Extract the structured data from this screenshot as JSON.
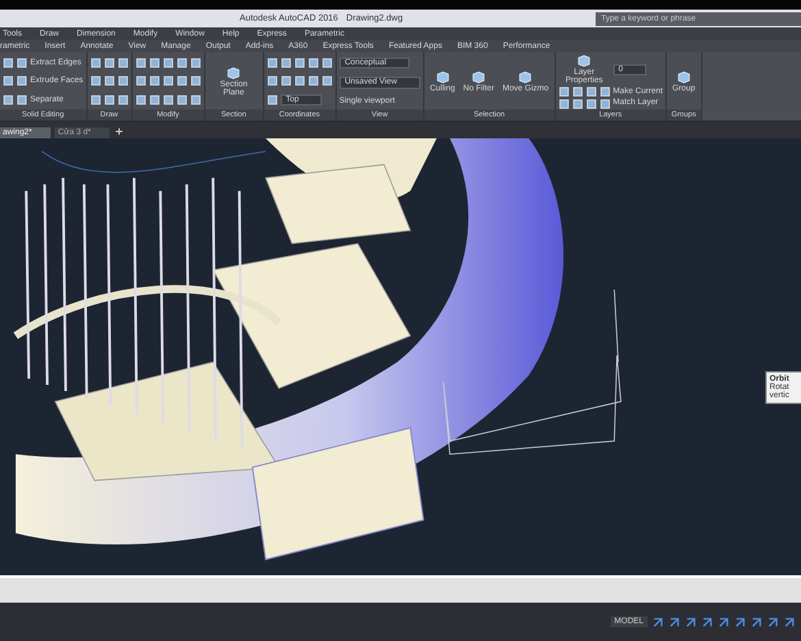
{
  "window": {
    "title": "Autodesk AutoCAD 2016",
    "document": "Drawing2.dwg"
  },
  "search": {
    "placeholder": "Type a keyword or phrase"
  },
  "menu": [
    "Tools",
    "Draw",
    "Dimension",
    "Modify",
    "Window",
    "Help",
    "Express",
    "Parametric"
  ],
  "ribbon_tabs": [
    "rametric",
    "Insert",
    "Annotate",
    "View",
    "Manage",
    "Output",
    "Add-ins",
    "A360",
    "Express Tools",
    "Featured Apps",
    "BIM 360",
    "Performance"
  ],
  "panels": [
    {
      "label": "Solid Editing",
      "rows": [
        [
          {
            "kind": "icon"
          },
          {
            "kind": "icon"
          },
          {
            "kind": "dropdown",
            "label": "Extract Edges"
          }
        ],
        [
          {
            "kind": "icon"
          },
          {
            "kind": "icon"
          },
          {
            "kind": "dropdown",
            "label": "Extrude Faces"
          }
        ],
        [
          {
            "kind": "icon"
          },
          {
            "kind": "icon"
          },
          {
            "kind": "dropdown",
            "label": "Separate"
          }
        ]
      ]
    },
    {
      "label": "Draw",
      "rows": [
        [
          {
            "kind": "icon"
          },
          {
            "kind": "icon"
          },
          {
            "kind": "icon"
          }
        ],
        [
          {
            "kind": "icon"
          },
          {
            "kind": "icon"
          },
          {
            "kind": "icon"
          }
        ],
        [
          {
            "kind": "icon"
          },
          {
            "kind": "icon"
          },
          {
            "kind": "icon"
          }
        ]
      ]
    },
    {
      "label": "Modify",
      "rows": [
        [
          {
            "kind": "icon"
          },
          {
            "kind": "icon"
          },
          {
            "kind": "icon"
          },
          {
            "kind": "icon"
          },
          {
            "kind": "icon"
          }
        ],
        [
          {
            "kind": "icon"
          },
          {
            "kind": "icon"
          },
          {
            "kind": "icon"
          },
          {
            "kind": "icon"
          },
          {
            "kind": "icon"
          }
        ],
        [
          {
            "kind": "icon"
          },
          {
            "kind": "icon"
          },
          {
            "kind": "icon"
          },
          {
            "kind": "icon"
          },
          {
            "kind": "icon"
          }
        ]
      ]
    },
    {
      "label": "Section",
      "rows": [
        [
          {
            "kind": "large",
            "label": "Section Plane"
          }
        ]
      ]
    },
    {
      "label": "Coordinates",
      "rows": [
        [
          {
            "kind": "icon"
          },
          {
            "kind": "icon"
          },
          {
            "kind": "icon"
          },
          {
            "kind": "icon"
          },
          {
            "kind": "icon"
          }
        ],
        [
          {
            "kind": "icon"
          },
          {
            "kind": "icon"
          },
          {
            "kind": "icon"
          },
          {
            "kind": "icon"
          },
          {
            "kind": "icon"
          }
        ],
        [
          {
            "kind": "icon"
          },
          {
            "kind": "select",
            "label": "Top"
          }
        ]
      ]
    },
    {
      "label": "View",
      "rows": [
        [
          {
            "kind": "select",
            "label": "Conceptual"
          }
        ],
        [
          {
            "kind": "select",
            "label": "Unsaved View"
          }
        ],
        [
          {
            "kind": "dropdown",
            "label": "Single viewport"
          }
        ]
      ]
    },
    {
      "label": "Selection",
      "rows": [
        [
          {
            "kind": "large",
            "label": "Culling"
          },
          {
            "kind": "large",
            "label": "No Filter"
          },
          {
            "kind": "large",
            "label": "Move Gizmo"
          }
        ]
      ]
    },
    {
      "label": "Layers",
      "rows": [
        [
          {
            "kind": "large",
            "label": "Layer Properties"
          },
          {
            "kind": "select",
            "label": "0"
          }
        ],
        [
          {
            "kind": "icon"
          },
          {
            "kind": "icon"
          },
          {
            "kind": "icon"
          },
          {
            "kind": "icon"
          },
          {
            "kind": "labeled",
            "label": "Make Current"
          }
        ],
        [
          {
            "kind": "icon"
          },
          {
            "kind": "icon"
          },
          {
            "kind": "icon"
          },
          {
            "kind": "icon"
          },
          {
            "kind": "labeled",
            "label": "Match Layer"
          }
        ]
      ]
    },
    {
      "label": "Groups",
      "rows": [
        [
          {
            "kind": "large",
            "label": "Group"
          }
        ]
      ]
    }
  ],
  "file_tabs": [
    {
      "label": "awing2*",
      "selected": true
    },
    {
      "label": "Cửa 3 d*",
      "selected": false
    }
  ],
  "tooltip": {
    "title": "Orbit",
    "lines": [
      "Rotat",
      "vertic"
    ]
  },
  "status_bar": {
    "mode": "MODEL"
  }
}
